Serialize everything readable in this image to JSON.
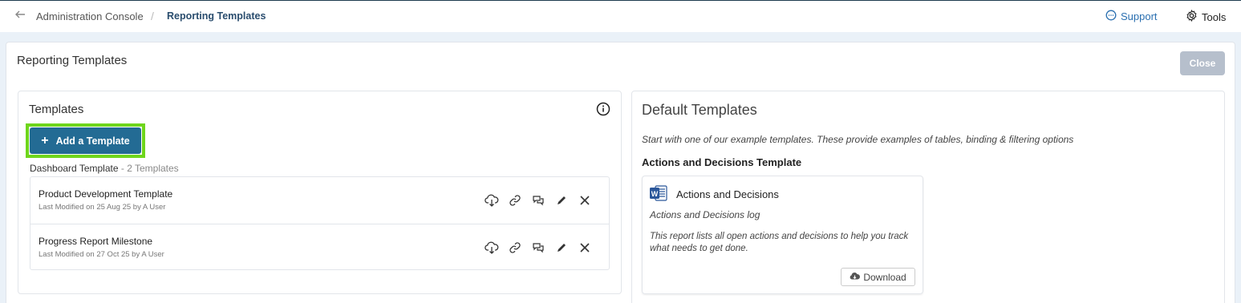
{
  "header": {
    "breadcrumb_parent": "Administration Console",
    "breadcrumb_separator": "/",
    "breadcrumb_current": "Reporting Templates",
    "support_label": "Support",
    "tools_label": "Tools"
  },
  "page": {
    "title": "Reporting Templates",
    "close_label": "Close"
  },
  "templates": {
    "title": "Templates",
    "add_label": "Add a Template",
    "group_name": "Dashboard Template",
    "group_count": "- 2 Templates",
    "items": [
      {
        "name": "Product Development Template",
        "meta": "Last Modified on 25 Aug 25  by  A User"
      },
      {
        "name": "Progress Report Milestone",
        "meta": "Last Modified on 27 Oct 25  by  A User"
      }
    ]
  },
  "defaults": {
    "title": "Default Templates",
    "description": "Start with one of our example templates. These provide examples of tables, binding & filtering options",
    "section_title": "Actions and Decisions Template",
    "card": {
      "name": "Actions and Decisions",
      "subtitle": "Actions and Decisions log",
      "description": "This report lists all open actions and decisions to help you track what needs to get done.",
      "download_label": "Download"
    }
  },
  "colors": {
    "accent": "#236b94",
    "highlight": "#6fd61c",
    "close_disabled": "#b6bfcc",
    "link": "#2a6fb0"
  }
}
